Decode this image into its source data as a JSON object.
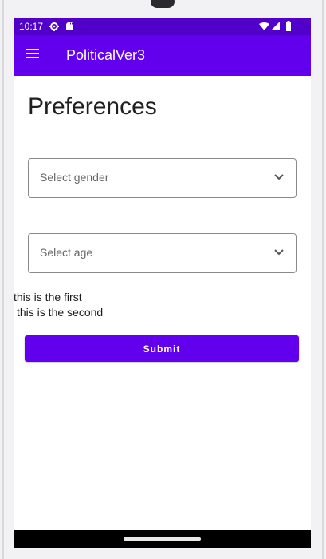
{
  "status_bar": {
    "time": "10:17",
    "icons": [
      "gear-icon",
      "sd-card-icon",
      "wifi-icon",
      "signal-icon",
      "battery-icon"
    ]
  },
  "app_bar": {
    "title": "PoliticalVer3",
    "menu_icon": "hamburger-menu-icon",
    "color": "#6200ee"
  },
  "page": {
    "title": "Preferences"
  },
  "gender_dropdown": {
    "placeholder": "Select gender"
  },
  "age_dropdown": {
    "placeholder": "Select age"
  },
  "text_lines": {
    "first": "this is the first",
    "second": "this is the second"
  },
  "submit": {
    "label": "Submit"
  },
  "colors": {
    "status_bar": "#5000c9",
    "primary": "#6200ee",
    "nav_bar": "#000000"
  }
}
